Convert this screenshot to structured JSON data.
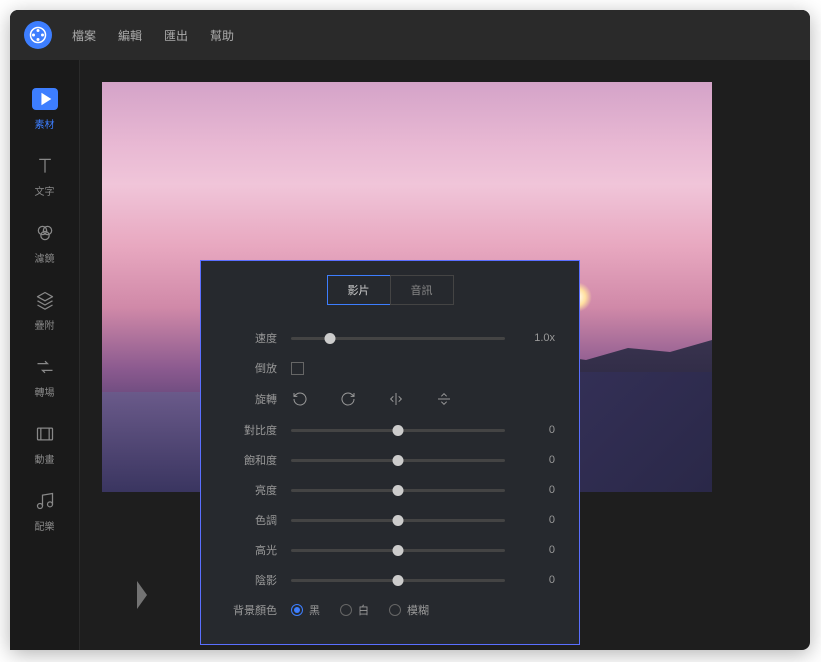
{
  "menu": {
    "file": "檔案",
    "edit": "編輯",
    "export": "匯出",
    "help": "幫助"
  },
  "sidebar": {
    "items": [
      {
        "label": "素材"
      },
      {
        "label": "文字"
      },
      {
        "label": "濾鏡"
      },
      {
        "label": "疊附"
      },
      {
        "label": "轉場"
      },
      {
        "label": "動畫"
      },
      {
        "label": "配樂"
      }
    ]
  },
  "panel": {
    "tabs": {
      "video": "影片",
      "audio": "音訊"
    },
    "speed": {
      "label": "速度",
      "value": "1.0x",
      "pos": 18
    },
    "reverse": {
      "label": "倒放"
    },
    "rotate": {
      "label": "旋轉"
    },
    "contrast": {
      "label": "對比度",
      "value": "0",
      "pos": 50
    },
    "saturation": {
      "label": "飽和度",
      "value": "0",
      "pos": 50
    },
    "brightness": {
      "label": "亮度",
      "value": "0",
      "pos": 50
    },
    "hue": {
      "label": "色調",
      "value": "0",
      "pos": 50
    },
    "highlight": {
      "label": "高光",
      "value": "0",
      "pos": 50
    },
    "shadow": {
      "label": "陰影",
      "value": "0",
      "pos": 50
    },
    "bgcolor": {
      "label": "背景顏色",
      "black": "黑",
      "white": "白",
      "blur": "模糊"
    }
  }
}
